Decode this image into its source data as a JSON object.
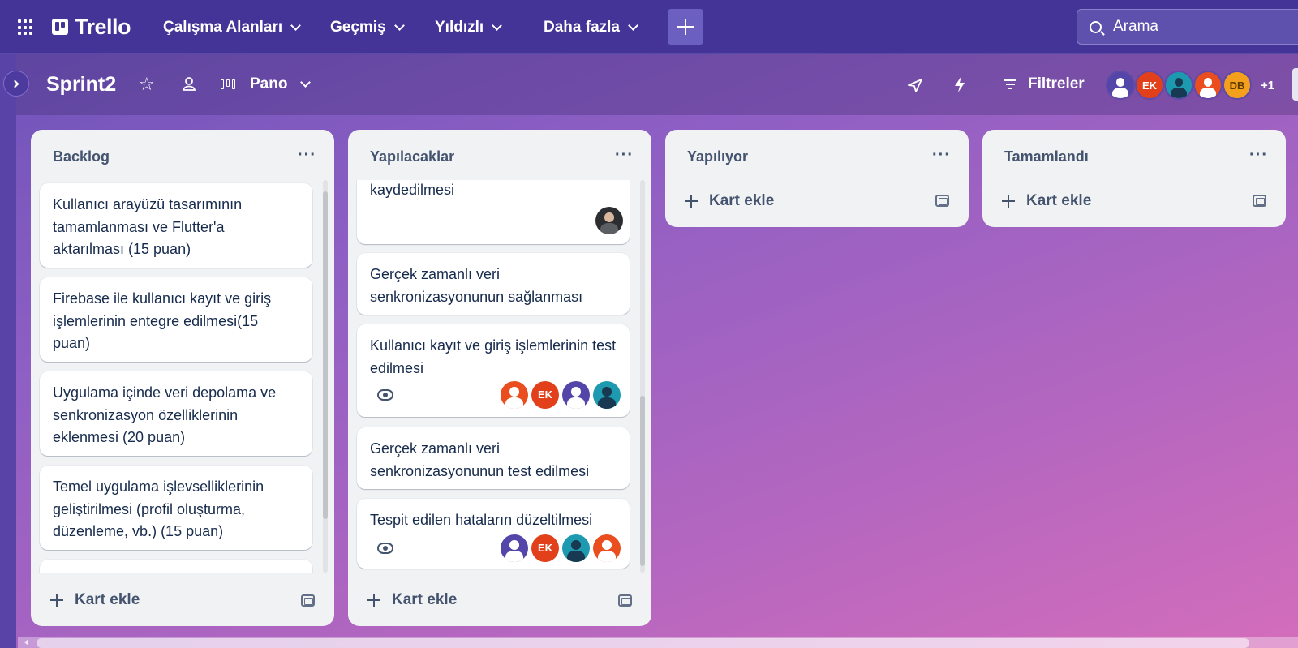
{
  "nav": {
    "app_name": "Trello",
    "menus": [
      "Çalışma Alanları",
      "Geçmiş",
      "Yıldızlı",
      "Daha fazla"
    ],
    "search_placeholder": "Arama"
  },
  "board": {
    "title": "Sprint2",
    "view": "Pano",
    "filter_label": "Filtreler",
    "members": [
      {
        "initials": "",
        "color": "#5346a8",
        "kind": "person-white"
      },
      {
        "initials": "EK",
        "color": "#e2401b",
        "kind": "initials"
      },
      {
        "initials": "",
        "color": "#1d9aaf",
        "kind": "person-dark"
      },
      {
        "initials": "",
        "color": "#ea4e1e",
        "kind": "person-white"
      },
      {
        "initials": "DB",
        "color": "#f5a01c",
        "kind": "initials"
      }
    ],
    "more_members": "+1"
  },
  "lists": [
    {
      "title": "Backlog",
      "add_card": "Kart ekle",
      "cards": [
        {
          "text": "Kullanıcı arayüzü tasarımının tamamlanması ve Flutter'a aktarılması (15 puan)"
        },
        {
          "text": "Firebase ile kullanıcı kayıt ve giriş işlemlerinin entegre edilmesi(15 puan)"
        },
        {
          "text": "Uygulama içinde veri depolama ve senkronizasyon özelliklerinin eklenmesi (20 puan)"
        },
        {
          "text": "Temel uygulama işlevselliklerinin geliştirilmesi (profil oluşturma, düzenleme, vb.) (15 puan)"
        }
      ]
    },
    {
      "title": "Yapılacaklar",
      "add_card": "Kart ekle",
      "cards": [
        {
          "text": "kaydedilmesi"
        },
        {
          "text": "Gerçek zamanlı veri senkronizasyonunun sağlanması"
        },
        {
          "text": "Kullanıcı kayıt ve giriş işlemlerinin test edilmesi",
          "avatar_initials": [
            "",
            "EK",
            "",
            ""
          ]
        },
        {
          "text": "Gerçek zamanlı veri senkronizasyonunun test edilmesi"
        },
        {
          "text": "Tespit edilen hataların düzeltilmesi",
          "avatar_initials": [
            "",
            "EK",
            "",
            ""
          ]
        }
      ]
    },
    {
      "title": "Yapılıyor",
      "add_card": "Kart ekle",
      "cards": []
    },
    {
      "title": "Tamamlandı",
      "add_card": "Kart ekle",
      "cards": []
    }
  ],
  "icons": [
    "apps-grid-icon",
    "trello-logo-icon",
    "plus-icon",
    "search-icon",
    "star-icon",
    "workspace-visibility-icon",
    "board-view-icon",
    "rocket-icon",
    "bolt-icon",
    "filter-icon",
    "ellipsis-icon",
    "template-icon",
    "eye-icon"
  ]
}
